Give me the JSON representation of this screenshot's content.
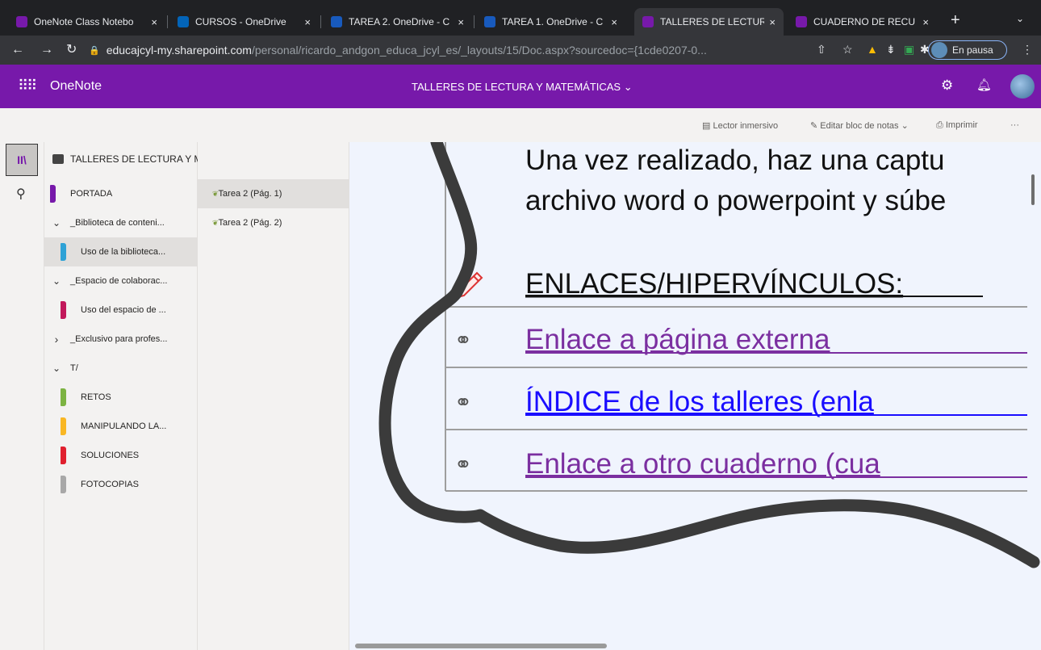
{
  "browser": {
    "tabs": [
      {
        "title": "OneNote Class Notebo",
        "icon": "onenote-class-notebook-icon",
        "color": "#7719aa",
        "active": false
      },
      {
        "title": "CURSOS - OneDrive",
        "icon": "onedrive-cloud-icon",
        "color": "#0364b8",
        "active": false
      },
      {
        "title": "TAREA 2. OneDrive - C",
        "icon": "word-icon",
        "color": "#185abd",
        "active": false
      },
      {
        "title": "TAREA 1. OneDrive - C",
        "icon": "word-icon",
        "color": "#185abd",
        "active": false
      },
      {
        "title": "TALLERES DE LECTUR",
        "icon": "onenote-icon",
        "color": "#7719aa",
        "active": true
      },
      {
        "title": "CUADERNO DE RECU",
        "icon": "onenote-icon",
        "color": "#7719aa",
        "active": false
      }
    ],
    "url_host": "educajcyl-my.sharepoint.com",
    "url_path": "/personal/ricardo_andgon_educa_jcyl_es/_layouts/15/Doc.aspx?sourcedoc={1cde0207-0...",
    "profile_label": "En pausa"
  },
  "app": {
    "name": "OneNote",
    "notebook_title": "TALLERES DE LECTURA Y MATEMÁTICAS ⌄",
    "accent": "#7719aa"
  },
  "commands": {
    "immersive_reader": "Lector inmersivo",
    "edit_notebook": "Editar bloc de notas ⌄",
    "print": "Imprimir",
    "more": "···"
  },
  "navigator": {
    "notebook_name": "TALLERES DE LECTURA Y MATEMÁTICAS",
    "sections": [
      {
        "label": "PORTADA",
        "type": "section",
        "color": "#7719aa"
      },
      {
        "label": "_Biblioteca de conteni...",
        "type": "group",
        "expanded": true
      },
      {
        "label": "Uso de la biblioteca...",
        "type": "section",
        "color": "#2ea2d6",
        "selected": true
      },
      {
        "label": "_Espacio de colaborac...",
        "type": "group",
        "expanded": true
      },
      {
        "label": "Uso del espacio de ...",
        "type": "section",
        "color": "#c2185b"
      },
      {
        "label": "_Exclusivo para profes...",
        "type": "group",
        "expanded": false
      },
      {
        "label": "T/",
        "type": "group",
        "expanded": true
      },
      {
        "label": "RETOS",
        "type": "section",
        "color": "#7cb342"
      },
      {
        "label": "MANIPULANDO LA...",
        "type": "section",
        "color": "#f9b724"
      },
      {
        "label": "SOLUCIONES",
        "type": "section",
        "color": "#e0202e"
      },
      {
        "label": "FOTOCOPIAS",
        "type": "section",
        "color": "#a8a8a8"
      }
    ],
    "pages": [
      {
        "label": "Tarea 2 (Pág. 1)",
        "selected": true
      },
      {
        "label": "Tarea 2 (Pág. 2)",
        "selected": false
      }
    ]
  },
  "content": {
    "line1": "Una vez realizado, haz una captu",
    "line2": "archivo word o powerpoint y súbe",
    "heading": "ENLACES/HIPERVÍNCULOS:",
    "links": [
      {
        "text": "Enlace a página externa",
        "color": "#7b2fa0"
      },
      {
        "text": "ÍNDICE  de los talleres (enla",
        "color": "#1a0dff"
      },
      {
        "text": "Enlace a otro cuaderno (cua",
        "color": "#7b2fa0"
      }
    ]
  }
}
